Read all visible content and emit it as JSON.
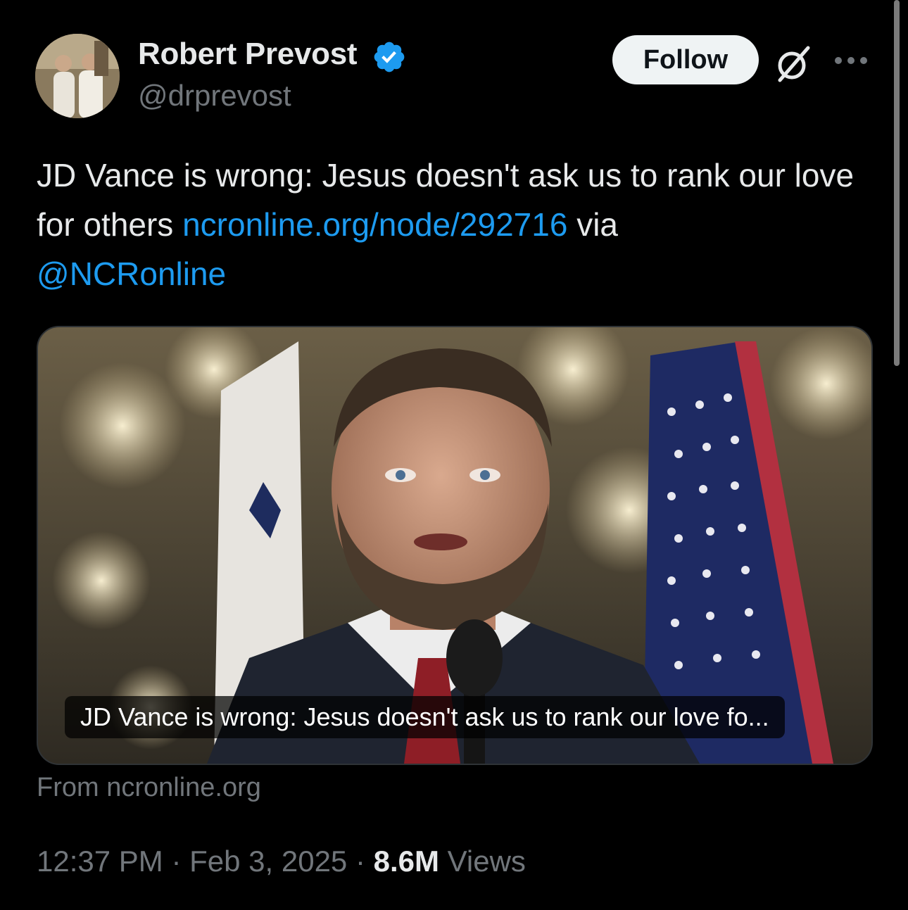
{
  "author": {
    "display_name": "Robert Prevost",
    "handle": "@drprevost",
    "verified": true,
    "avatar_icon": "avatar-photo"
  },
  "header_actions": {
    "follow_label": "Follow",
    "grok_icon": "grok-icon",
    "more_icon": "more-icon"
  },
  "tweet": {
    "text_before_link": "JD Vance is wrong: Jesus doesn't ask us to rank our love for others ",
    "link_text": "ncronline.org/node/292716",
    "text_after_link": " via ",
    "mention": "@NCRonline"
  },
  "card": {
    "caption": "JD Vance is wrong: Jesus doesn't ask us to rank our love fo...",
    "source": "From ncronline.org"
  },
  "meta": {
    "time": "12:37 PM",
    "separator": " · ",
    "date": "Feb 3, 2025",
    "views_count": "8.6M",
    "views_label": " Views"
  },
  "colors": {
    "background": "#000000",
    "link": "#1d9bf0",
    "verified": "#1d9bf0",
    "secondary_text": "#71767b",
    "primary_text": "#e7e9ea"
  }
}
